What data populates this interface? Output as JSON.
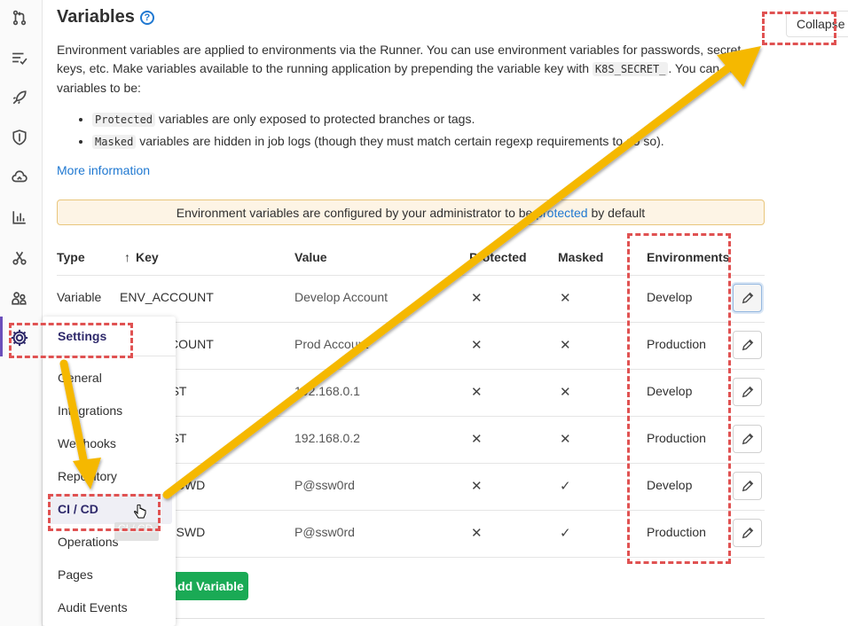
{
  "page": {
    "title": "Variables",
    "help_icon": "question-circle-icon",
    "collapse_label": "Collapse",
    "description_1": "Environment variables are applied to environments via the Runner. You can use environment variables for passwords, secret keys, etc. Make variables available to the running application by prepending the variable key with ",
    "description_code": "K8S_SECRET_",
    "description_2": ". You can set variables to be:",
    "bullets": [
      {
        "code": "Protected",
        "text": " variables are only exposed to protected branches or tags."
      },
      {
        "code": "Masked",
        "text": " variables are hidden in job logs (though they must match certain regexp requirements to do so)."
      }
    ],
    "more_info": "More information",
    "alert_pre": "Environment variables are configured by your administrator to be ",
    "alert_link": "protected",
    "alert_post": " by default"
  },
  "table": {
    "headers": {
      "type": "Type",
      "key": "Key",
      "key_sort_icon": "arrow-up-icon",
      "value": "Value",
      "protected": "Protected",
      "masked": "Masked",
      "environments": "Environments"
    },
    "rows": [
      {
        "type": "Variable",
        "key": "ENV_ACCOUNT",
        "value": "Develop Account",
        "protected": false,
        "masked": false,
        "environment": "Develop"
      },
      {
        "type": "Variable",
        "key": "ENV_ACCOUNT",
        "value": "Prod Account",
        "protected": false,
        "masked": false,
        "environment": "Production"
      },
      {
        "type": "Variable",
        "key": "ENV_HOST",
        "value": "192.168.0.1",
        "protected": false,
        "masked": false,
        "environment": "Develop"
      },
      {
        "type": "Variable",
        "key": "ENV_HOST",
        "value": "192.168.0.2",
        "protected": false,
        "masked": false,
        "environment": "Production"
      },
      {
        "type": "Variable",
        "key": "ENV_PASSWD",
        "value": "P@ssw0rd",
        "protected": false,
        "masked": true,
        "environment": "Develop"
      },
      {
        "type": "Variable",
        "key": "ENV_PASSWD",
        "value": "P@ssw0rd",
        "protected": false,
        "masked": true,
        "environment": "Production"
      }
    ],
    "add_button": "Add Variable",
    "visible_keys": [
      "ENV_ACCOUNT",
      "OUNT",
      "T",
      "T",
      "WD",
      "SWD"
    ],
    "visible_values": [
      "Develop Account",
      "Prod Accou",
      "1 2.168.0.1",
      "192.168.0.2",
      "P@ssw0rd",
      "P@ssw0rd"
    ]
  },
  "flyout": {
    "header": "Settings",
    "items": [
      "General",
      "Integrations",
      "Webhooks",
      "Repository",
      "CI / CD",
      "Operations",
      "Pages",
      "Audit Events"
    ],
    "active": "CI / CD",
    "tooltip": "CI / CD"
  },
  "sidebar_icons": [
    "merge-request-icon",
    "issues-list-icon",
    "rocket-icon",
    "shield-icon",
    "cloud-icon",
    "chart-icon",
    "scissors-icon",
    "users-icon",
    "gear-icon"
  ],
  "colors": {
    "annotation": "#e05252",
    "arrow": "#f5b800",
    "accent": "#1f78d1",
    "success": "#1aaa55",
    "alert_bg": "#fdf4e5"
  }
}
